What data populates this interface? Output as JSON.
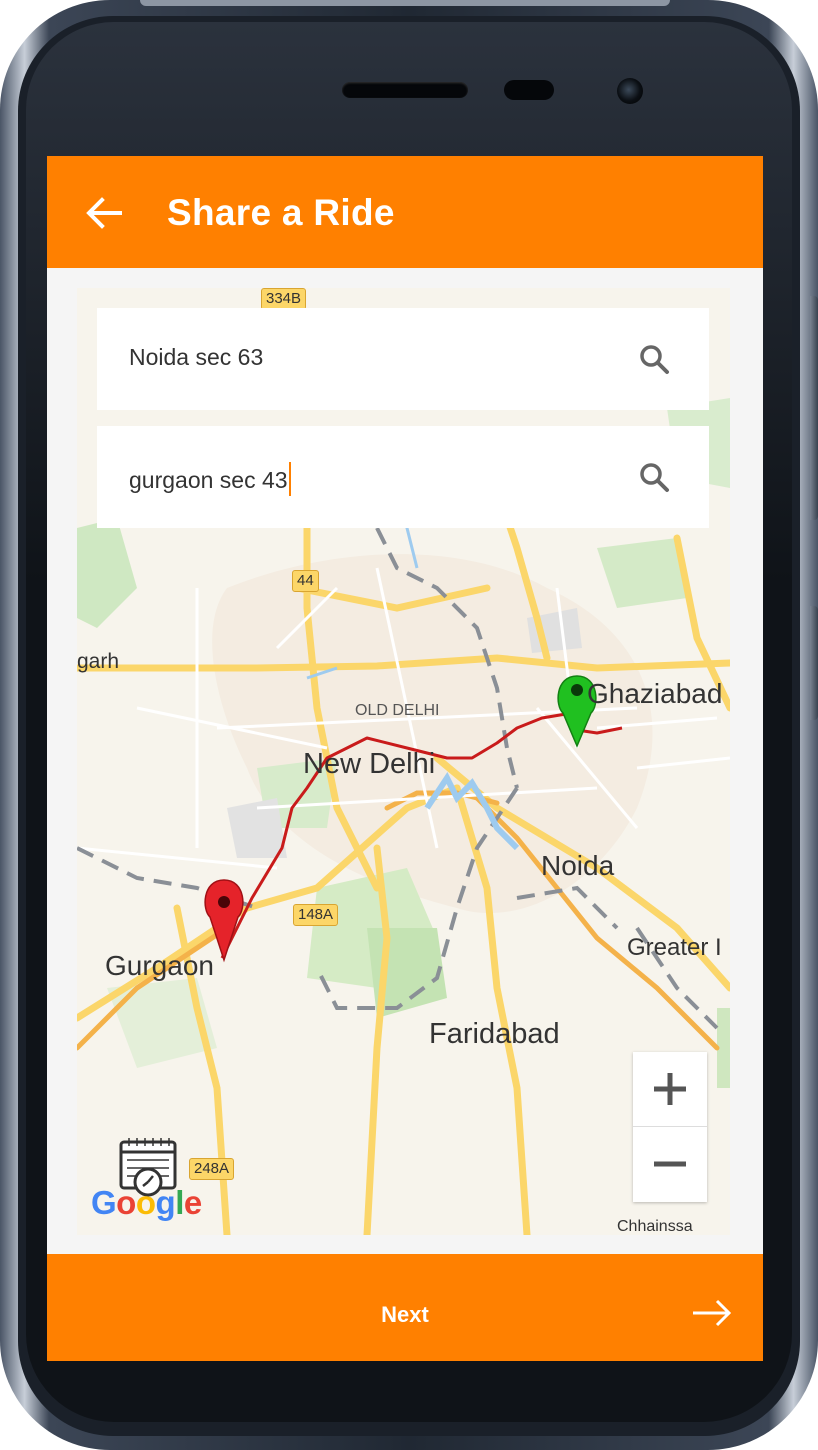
{
  "app": {
    "title": "Share a Ride",
    "back_icon": "arrow-left-icon",
    "accent_color": "#ff8000"
  },
  "search": {
    "from_value": "Noida sec 63",
    "to_value": "gurgaon sec 43",
    "search_icon": "search-icon"
  },
  "map": {
    "labels": {
      "ghaziabad": "Ghaziabad",
      "old_delhi": "OLD DELHI",
      "new_delhi": "New Delhi",
      "noida": "Noida",
      "gurgaon": "Gurgaon",
      "faridabad": "Faridabad",
      "greater_noida": "Greater I",
      "garh": "garh",
      "chhainssa": "Chhainssa"
    },
    "shields": {
      "r334b": "334B",
      "r44": "44",
      "r148a": "148A",
      "r248a": "248A"
    },
    "google_logo": "Google",
    "zoom_in_icon": "plus-icon",
    "zoom_out_icon": "minus-icon",
    "origin_marker_color": "#20c020",
    "destination_marker_color": "#e5232a",
    "route_color": "#c91b1b"
  },
  "footer": {
    "next_label": "Next",
    "next_icon": "arrow-right-icon"
  }
}
